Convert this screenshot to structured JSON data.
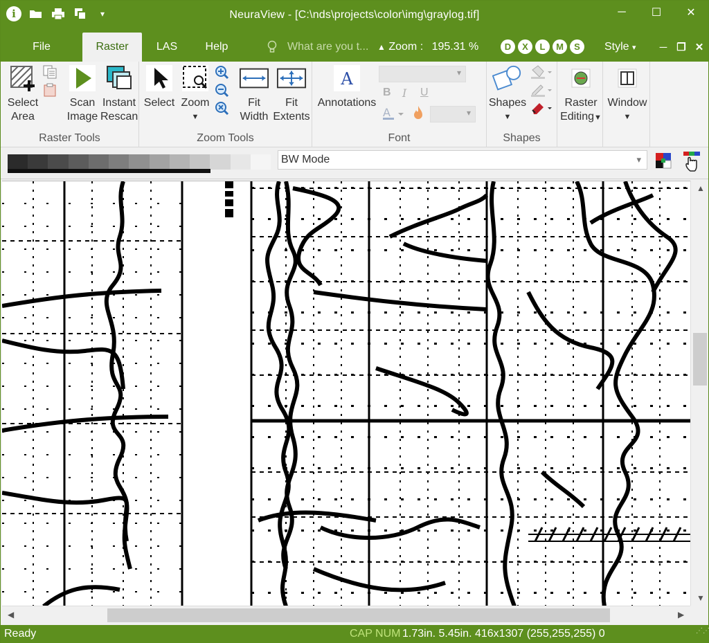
{
  "window": {
    "title": "NeuraView - [C:\\nds\\projects\\color\\img\\graylog.tif]",
    "controls": {
      "minimize": "─",
      "maximize": "☐",
      "close": "✕"
    }
  },
  "quick_access": [
    "info-icon",
    "open-folder-icon",
    "print-icon",
    "copy-window-icon",
    "customize-dropdown-icon"
  ],
  "menu": {
    "tabs": [
      {
        "label": "File"
      },
      {
        "label": "Raster"
      },
      {
        "label": "LAS"
      },
      {
        "label": "Help"
      }
    ],
    "active_tab": "Raster",
    "search_placeholder": "What are you t...",
    "zoom_label": "Zoom :",
    "zoom_value": "195.31 %",
    "view_letters": [
      "D",
      "X",
      "L",
      "M",
      "S"
    ],
    "style_label": "Style"
  },
  "ribbon": {
    "raster_tools": {
      "label": "Raster Tools",
      "select_area": [
        "Select",
        "Area"
      ],
      "scan_image": [
        "Scan",
        "Image"
      ],
      "instant_rescan": [
        "Instant",
        "Rescan"
      ]
    },
    "zoom_tools": {
      "label": "Zoom Tools",
      "select": "Select",
      "zoom": "Zoom",
      "fit_width": [
        "Fit",
        "Width"
      ],
      "fit_extents": [
        "Fit",
        "Extents"
      ]
    },
    "font": {
      "label": "Font",
      "annotations": "Annotations",
      "bold": "B",
      "italic": "I",
      "underline": "U"
    },
    "shapes": {
      "label": "Shapes",
      "shapes": "Shapes"
    },
    "raster_editing": [
      "Raster",
      "Editing"
    ],
    "window": "Window"
  },
  "modebar": {
    "mode": "BW Mode",
    "ramp_colors": [
      "#2b2b2b",
      "#3a3a3a",
      "#4b4b4b",
      "#5c5c5c",
      "#6d6d6d",
      "#7e7e7e",
      "#909090",
      "#a2a2a2",
      "#b4b4b4",
      "#c5c5c5",
      "#d6d6d6",
      "#e7e7e7",
      "#f5f5f5"
    ]
  },
  "status": {
    "ready": "Ready",
    "caps": "CAP NUM",
    "readout": "1.73in. 5.45in. 416x1307 (255,255,255) 0"
  },
  "colors": {
    "accent": "#5d8f1e",
    "tab_text": "#3a6d0e"
  }
}
